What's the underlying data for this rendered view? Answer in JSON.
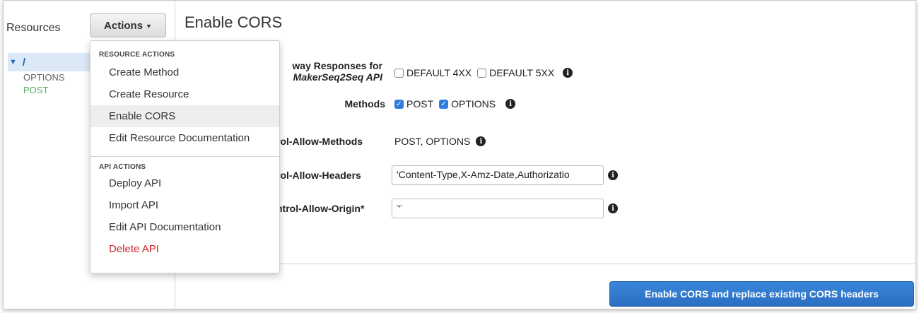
{
  "left_pane": {
    "title": "Resources",
    "actions_button": "Actions",
    "tree": {
      "root": "/",
      "methods": [
        "OPTIONS",
        "POST"
      ]
    }
  },
  "main": {
    "title": "Enable CORS",
    "rows": {
      "gateway_label_1": "way Responses for",
      "gateway_label_2": "MakerSeq2Seq API",
      "default_4xx": "DEFAULT 4XX",
      "default_5xx": "DEFAULT 5XX",
      "methods_label": "Methods",
      "method_post": "POST",
      "method_options": "OPTIONS",
      "allow_methods_label": "rol-Allow-Methods",
      "allow_methods_value": "POST, OPTIONS",
      "allow_headers_label": "rol-Allow-Headers",
      "allow_headers_value": "'Content-Type,X-Amz-Date,Authorizatio",
      "allow_origin_label": "ntrol-Allow-Origin*",
      "allow_origin_value": "'*'"
    },
    "submit_button": "Enable CORS and replace existing CORS headers"
  },
  "actions_menu": {
    "resource_section": "RESOURCE ACTIONS",
    "resource_items": [
      "Create Method",
      "Create Resource",
      "Enable CORS",
      "Edit Resource Documentation"
    ],
    "api_section": "API ACTIONS",
    "api_items": [
      "Deploy API",
      "Import API",
      "Edit API Documentation",
      "Delete API"
    ]
  },
  "colors": {
    "primary_button": "#2a6fc4",
    "post_method": "#56a95a",
    "delete": "#d0202a"
  }
}
